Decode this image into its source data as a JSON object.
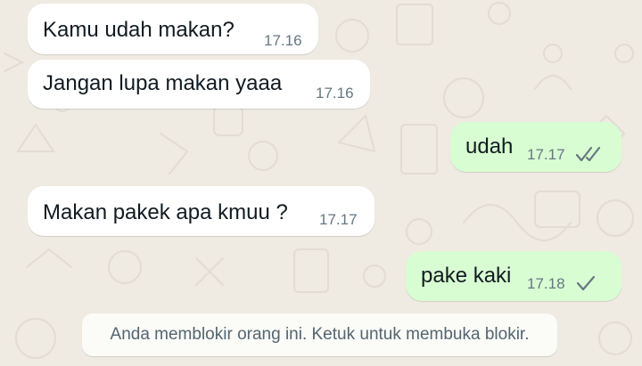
{
  "colors": {
    "background": "#efeae2",
    "incoming_bubble": "#ffffff",
    "outgoing_bubble": "#d9fdd3",
    "text": "#111b21",
    "time": "#667781",
    "ticks": "#667781"
  },
  "messages": [
    {
      "direction": "in",
      "text": "Kamu udah makan?",
      "time": "17.16"
    },
    {
      "direction": "in",
      "text": "Jangan lupa makan yaaa",
      "time": "17.16"
    },
    {
      "direction": "out",
      "text": "udah",
      "time": "17.17",
      "status": "double-check-icon"
    },
    {
      "direction": "in",
      "text": "Makan pakek apa kmuu ?",
      "time": "17.17"
    },
    {
      "direction": "out",
      "text": "pake kaki",
      "time": "17.18",
      "status": "single-check-icon"
    }
  ],
  "blocked_notice": {
    "text": "Anda memblokir orang ini. Ketuk untuk membuka blokir."
  }
}
